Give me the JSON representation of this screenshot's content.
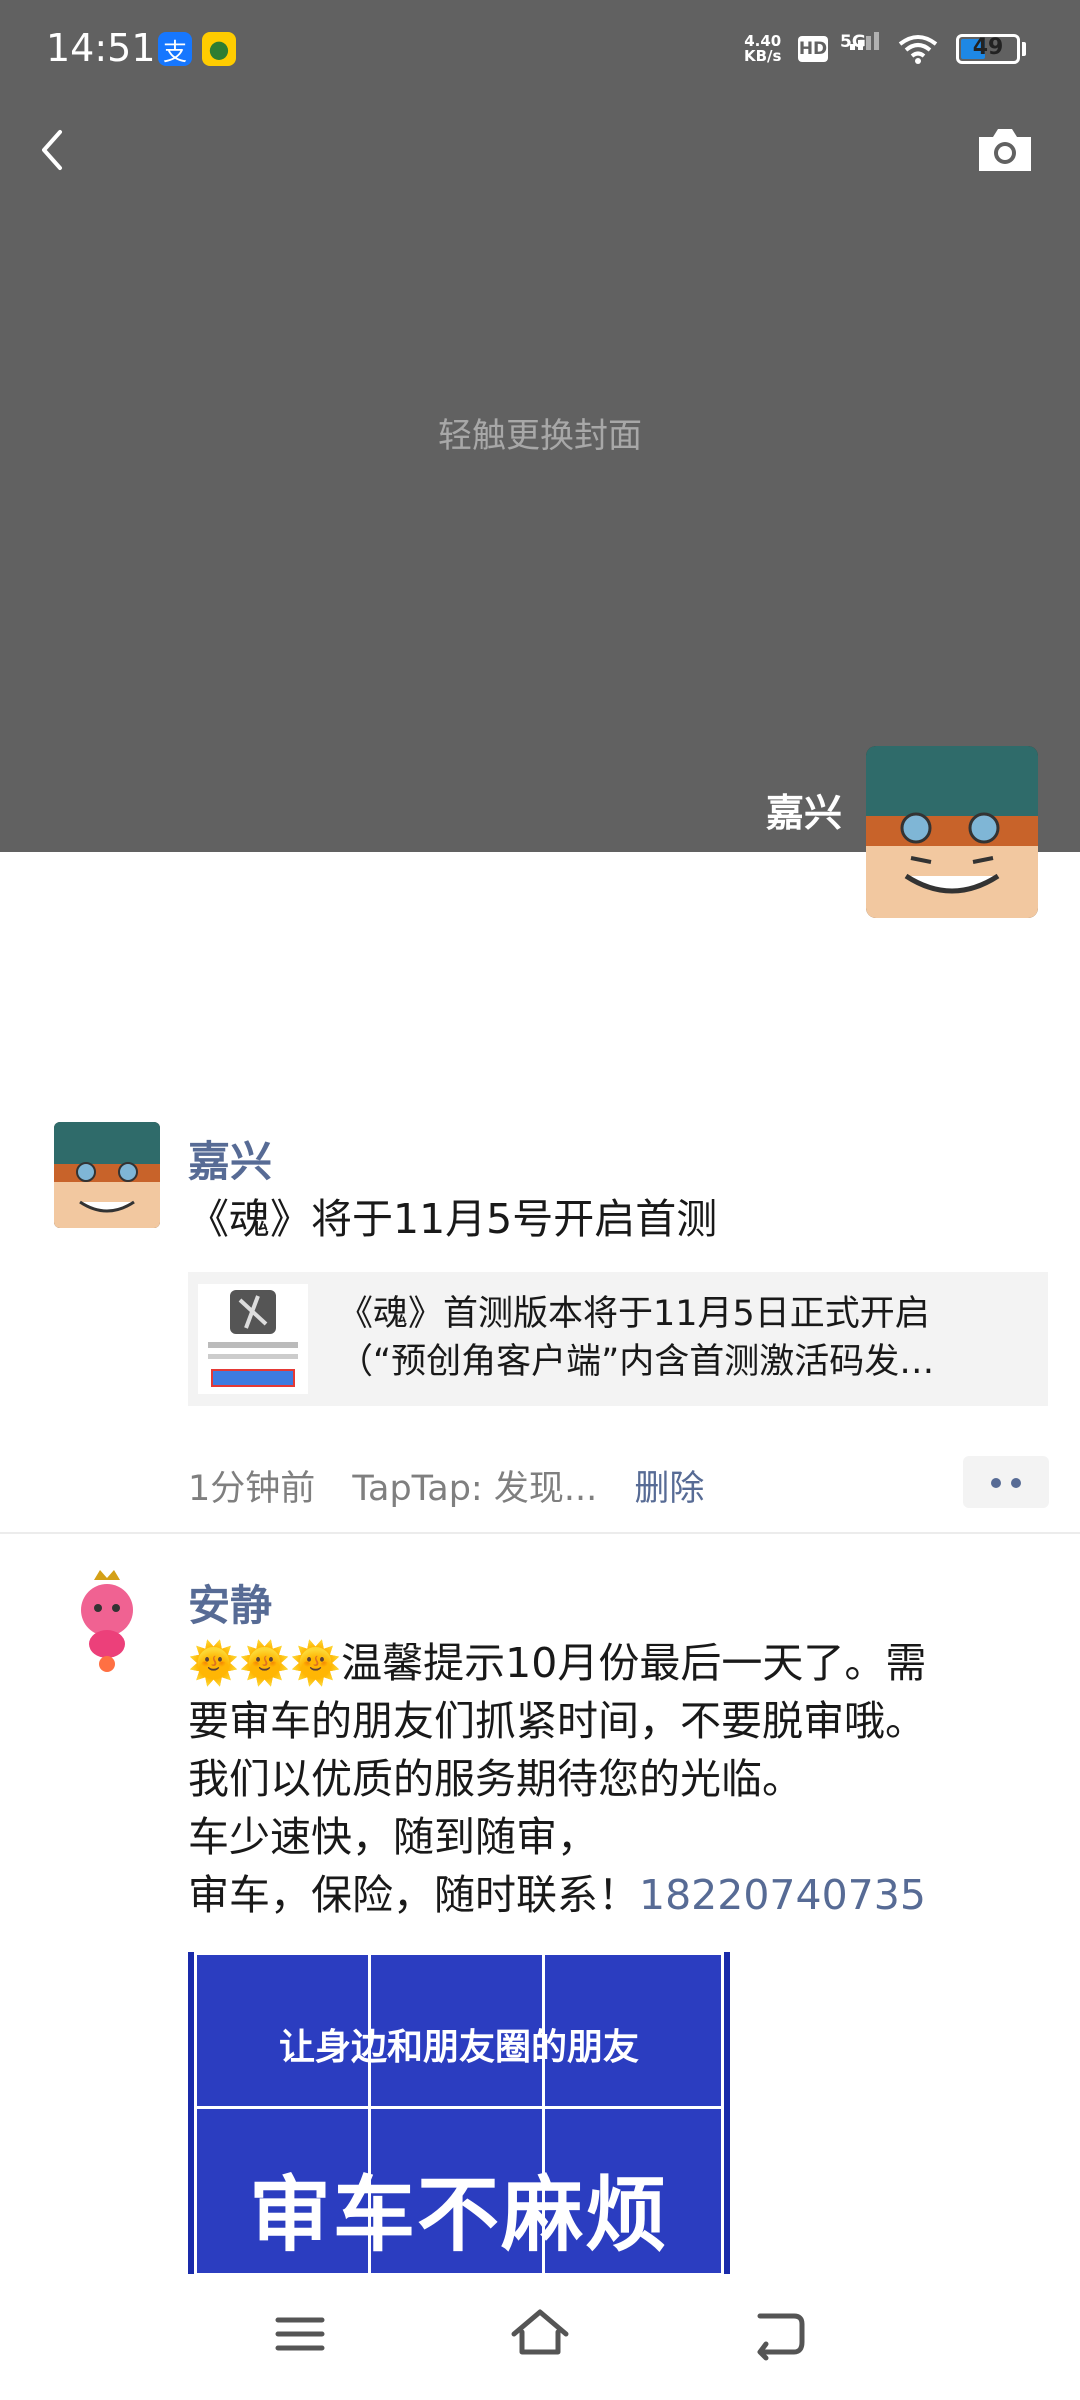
{
  "status_bar": {
    "time": "14:51",
    "net_speed_value": "4.40",
    "net_speed_unit": "KB/s",
    "hd_label": "HD",
    "signal_label": "5G",
    "battery_level": "49",
    "app_badges": [
      "alipay-icon",
      "app-icon"
    ]
  },
  "cover": {
    "hint": "轻触更换封面",
    "profile_name": "嘉兴"
  },
  "posts": [
    {
      "author": "嘉兴",
      "text": "《魂》将于11月5号开启首测",
      "link": {
        "title_line1": "《魂》首测版本将于11月5日正式开启",
        "title_line2": "（“预创角客户端”内含首测激活码发…"
      },
      "time": "1分钟前",
      "source": "TapTap: 发现...",
      "delete_label": "删除"
    },
    {
      "author": "安静",
      "sun_emojis": "🌞🌞🌞",
      "line1": "温馨提示10月份最后一天了。需",
      "line2": "要审车的朋友们抓紧时间，不要脱审哦。",
      "line3": "我们以优质的服务期待您的光临。",
      "line4": "车少速快，随到随审，",
      "line5": "审车，保险，随时联系！",
      "phone": "18220740735",
      "image": {
        "line1": "让身边和朋友圈的朋友",
        "line2": "审车不麻烦"
      }
    }
  ],
  "colors": {
    "cover_bg": "#616161",
    "link_blue": "#576b95",
    "text": "#191919"
  }
}
